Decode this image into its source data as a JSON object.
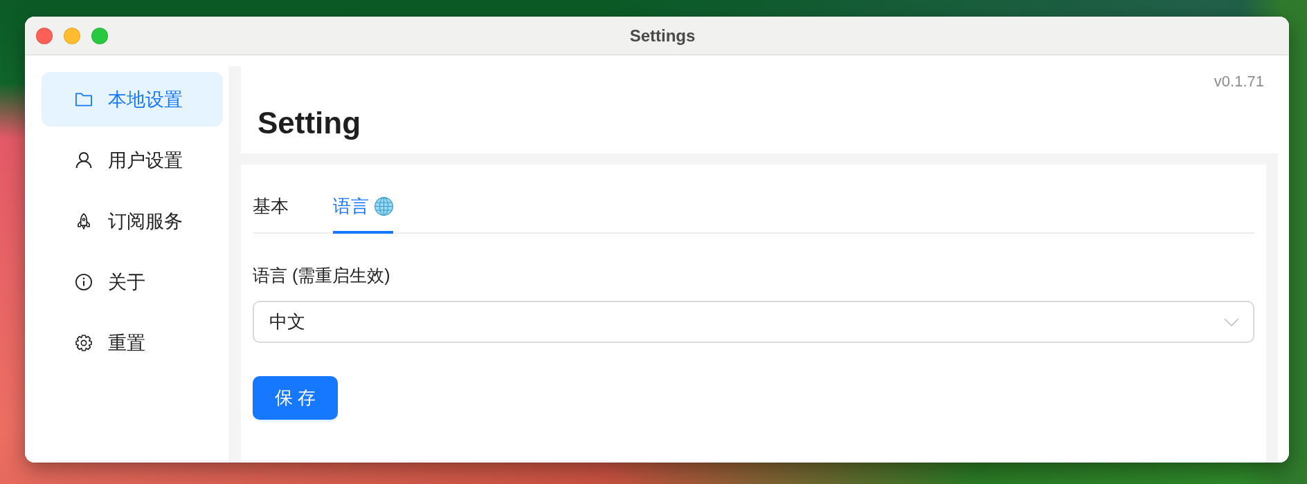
{
  "window": {
    "title": "Settings"
  },
  "sidebar": {
    "items": [
      {
        "label": "本地设置",
        "selected": true
      },
      {
        "label": "用户设置",
        "selected": false
      },
      {
        "label": "订阅服务",
        "selected": false
      },
      {
        "label": "关于",
        "selected": false
      },
      {
        "label": "重置",
        "selected": false
      }
    ]
  },
  "header": {
    "version": "v0.1.71",
    "title": "Setting"
  },
  "tabs": [
    {
      "label": "基本",
      "selected": false
    },
    {
      "label": "语言",
      "selected": true
    }
  ],
  "form": {
    "language": {
      "label": "语言 (需重启生效)",
      "value": "中文"
    },
    "save_button": "保 存"
  }
}
